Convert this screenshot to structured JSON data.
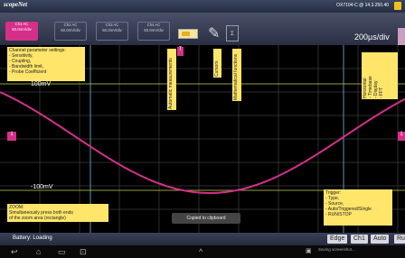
{
  "titlebar": {
    "logo": "scopeNet",
    "device": "OX7104-C @ 14.3.250.40"
  },
  "channels": [
    {
      "label": "Ch1  AC",
      "scale": "50.0mV/div"
    },
    {
      "label": "Ch2  AC",
      "scale": "50.0mV/div"
    },
    {
      "label": "Ch3  AC",
      "scale": "50.0mV/div"
    },
    {
      "label": "Ch4  AC",
      "scale": "50.0mV/div"
    }
  ],
  "toolbar": {
    "timebase": "200µs/div",
    "fn_icon": "Σ"
  },
  "notes": {
    "channel": "Channel parameter settings:\n- Sensitivity,\n- Coupling,\n- Bandwidth limit,\n- Probe Coefficient",
    "auto_measure": "Automatic measurements",
    "cursors": "Cursors",
    "math": "Mathematical functions",
    "horizontal": "Horizontal\n- Timebase\n- Display\n- FFT",
    "zoom": "ZOOM:\nSimultaneously press both ends\nof the zoom area (rectangle)",
    "trigger": "Trigger:\n- Type,\n- Source,\n- Auto/Triggered/Single\n- RUN/STOP"
  },
  "levels": {
    "top": "100mV",
    "bottom": "-100mV",
    "left_marker": "1",
    "right_marker": "1",
    "trigger_marker": "T"
  },
  "toast": "Copied to clipboard",
  "status": {
    "battery": "Battery: Loading",
    "edge": "Edge",
    "ch": "Ch1",
    "auto": "Auto",
    "run": "Ru",
    "saving": "Saving screenshot..."
  },
  "colors": {
    "trace": "#d52f8a",
    "grid": "#3a3a3a",
    "level_line": "#c8d84a",
    "note_bg": "#ffe56a"
  }
}
